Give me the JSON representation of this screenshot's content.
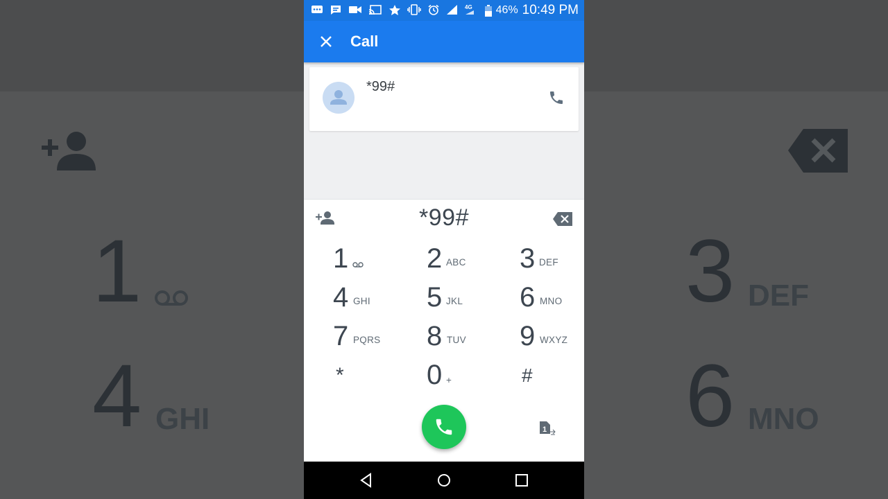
{
  "status_bar": {
    "battery_percent": "46%",
    "time": "10:49 PM",
    "network": "4G",
    "icons": [
      "message-icon",
      "chat-icon",
      "video-icon",
      "cast-icon",
      "star-icon",
      "vibrate-icon",
      "alarm-icon",
      "signal-icon",
      "battery-icon"
    ]
  },
  "app_bar": {
    "title": "Call",
    "close_icon": "close-icon"
  },
  "suggestion": {
    "number": "*99#",
    "avatar_icon": "person-icon",
    "action_icon": "phone-icon"
  },
  "dialpad": {
    "entered": "*99#",
    "keys": [
      {
        "digit": "1",
        "letters": "",
        "icon": "voicemail-icon"
      },
      {
        "digit": "2",
        "letters": "ABC"
      },
      {
        "digit": "3",
        "letters": "DEF"
      },
      {
        "digit": "4",
        "letters": "GHI"
      },
      {
        "digit": "5",
        "letters": "JKL"
      },
      {
        "digit": "6",
        "letters": "MNO"
      },
      {
        "digit": "7",
        "letters": "PQRS"
      },
      {
        "digit": "8",
        "letters": "TUV"
      },
      {
        "digit": "9",
        "letters": "WXYZ"
      },
      {
        "digit": "*",
        "letters": ""
      },
      {
        "digit": "0",
        "letters": "+"
      },
      {
        "digit": "#",
        "letters": ""
      }
    ],
    "sim_label": "1"
  },
  "background": {
    "left_digit_1": "1",
    "left_digit_4": "4",
    "left_letters_4": "GHI",
    "right_digit_3": "3",
    "right_letters_3": "DEF",
    "right_digit_6": "6",
    "right_letters_6": "MNO"
  },
  "colors": {
    "primary": "#1b7bee",
    "status_bar": "#1976e0",
    "call_green": "#1ec65a",
    "text": "#3d4650"
  }
}
